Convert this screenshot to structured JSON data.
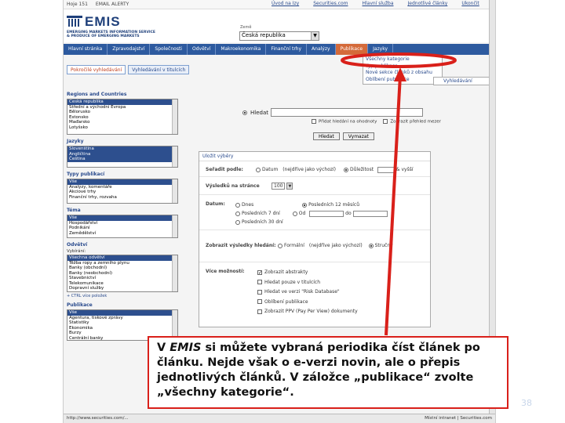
{
  "topbar": {
    "home": "Hoje 151",
    "alerts": "EMAIL ALERTY",
    "links": [
      "Úvod na Izy",
      "Securities.com",
      "Hlavní služba",
      "Jednotlivé články",
      "Ukončit"
    ]
  },
  "header": {
    "logo_text": "EMIS",
    "logo_sub_1": "EMERGING MARKETS INFORMATION SERVICE",
    "logo_sub_2": "& PRODUCE OF EMERGING MARKETS",
    "country_label": "Země",
    "country_value": "Česká republika"
  },
  "nav": {
    "items": [
      "Hlavní stránka",
      "Zpravodajství",
      "Společnosti",
      "Odvětví",
      "Makroekonomika",
      "Finanční trhy",
      "Analýzy",
      "Publikace",
      "Jazyky"
    ],
    "active_index": 7
  },
  "dropdown": {
    "items": [
      "Všechny kategorie",
      "Typ publikace",
      "Nové sekce článků z obsahu",
      "Oblíbení publikace"
    ]
  },
  "subtabs": [
    "Pokročilé vyhledávání",
    "Vyhledávání v titulcích"
  ],
  "save_search": "Vyhledávání",
  "left": {
    "regions_title": "Regions and Countries",
    "regions": [
      "Česká republika",
      "Střední a východní Evropa",
      "Bělorusko",
      "Estonsko",
      "Maďarsko",
      "Lotyšsko"
    ],
    "languages_title": "Jazyky",
    "languages": [
      "Slovenština",
      "Angličtina",
      "Čeština"
    ],
    "pubtypes_title": "Typy publikací",
    "pubtypes": [
      "Vše",
      "Analýzy, komentáře",
      "Akciové trhy",
      "Finanční trhy, rozvaha"
    ],
    "topic_title": "Téma",
    "topics": [
      "Vše",
      "Hospodářství",
      "Podnikání",
      "Zemědělství"
    ],
    "industry_title": "Odvětví",
    "industry_label": "Vybírání:",
    "industries": [
      "Všechna odvětví",
      "Těžba ropy a zemního plynu",
      "Banky (obchodní)",
      "Banky (neobchodní)",
      "Stavebnictví",
      "Telekomunikace",
      "Dopravní služby"
    ],
    "industry_note": "+ CTRL více položek",
    "publications_title": "Publikace",
    "publications": [
      "Vše",
      "Agentura, tiskové zprávy",
      "Statistiky",
      "Ekonomika",
      "Burzy",
      "Centrální banky"
    ]
  },
  "search": {
    "option_label": "Hledat",
    "opt1": "Přidat hledání na ohodnoty",
    "opt2": "Zobrazit přehled mezer",
    "btn_search": "Hledat",
    "btn_clear": "Vymazat"
  },
  "filters": {
    "title": "Uložit výběry",
    "sort_label": "Seřadit podle:",
    "sort_opt1": "Datum",
    "sort_opt1_note": "(nejdříve jako výchozí)",
    "sort_opt2": "Důležitost",
    "sort_opt2_suffix": "& vyšší",
    "perpage_label": "Výsledků na stránce",
    "perpage_value": "100",
    "date_label": "Datum:",
    "date_opts": [
      "Dnes",
      "Posledních 12 měsíců",
      "Posledních 7 dní",
      "Od",
      "do",
      "Posledních 30 dní"
    ],
    "display_label": "Zobrazit výsledky hledání:",
    "display_opt1": "Formální",
    "display_opt1_note": "(nejdříve jako výchozí)",
    "display_opt2": "Stručný",
    "more_label": "Více možností:",
    "more_opts": [
      "Zobrazit abstrakty",
      "Hledat pouze v titulcích",
      "Hledat ve verzi \"Risk Database\"",
      "Oblíbení publikace",
      "Zobrazit PPV (Pay Per View) dokumenty"
    ]
  },
  "status": {
    "left": "http://www.securities.com/...",
    "right": "Místní intranet | Securities.com"
  },
  "callout": {
    "text_prefix": "V ",
    "text_emis": "EMIS",
    "text_body": " si můžete vybraná periodika číst článek po článku. Nejde však o e-verzi novin, ale o přepis jednotlivých článků. V záložce „publikace“ zvolte „všechny kategorie“."
  },
  "page_number": "38",
  "colors": {
    "nav_blue": "#2d5a9f",
    "active_tab": "#d46a3a",
    "annotation_red": "#d9201a"
  }
}
